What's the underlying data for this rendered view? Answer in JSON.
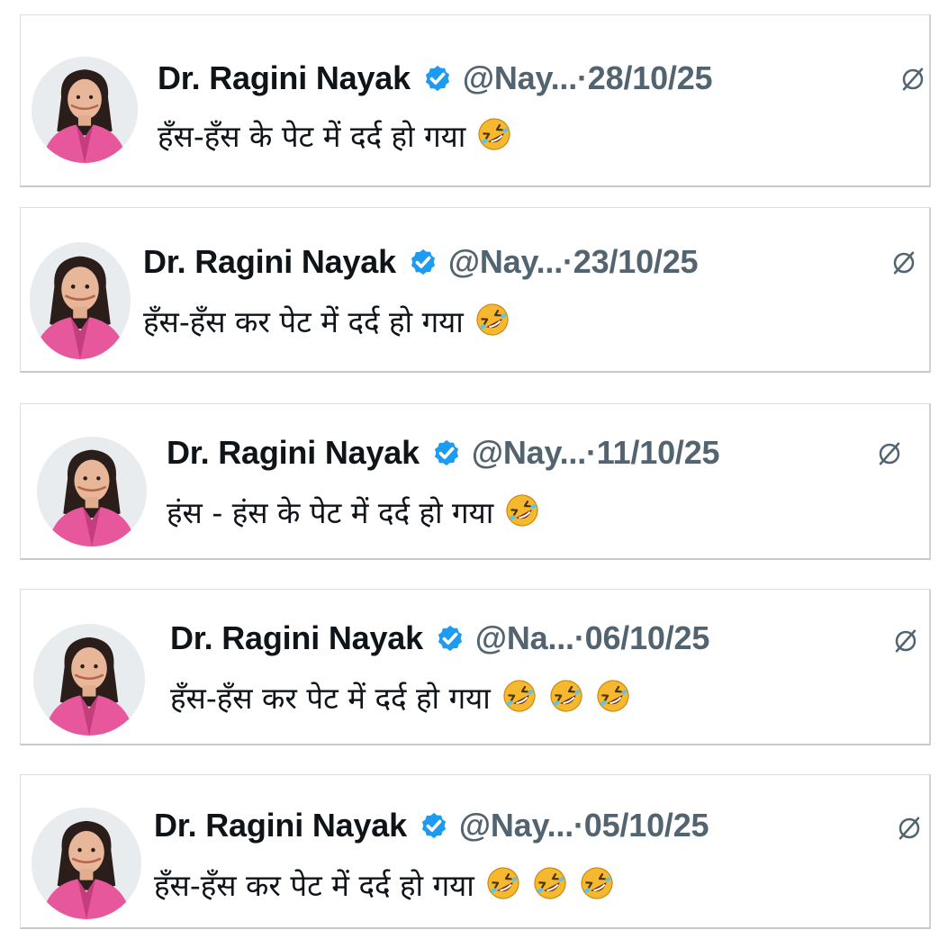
{
  "colors": {
    "name": "#0f1419",
    "secondary": "#536471",
    "verified": "#1d9bf0",
    "avatar_outfit": "#e6579b"
  },
  "icons": {
    "verified": "verified-badge-icon",
    "grok": "grok-icon",
    "emoji": "rolling-on-the-floor-laughing-emoji"
  },
  "tweets": [
    {
      "name": "Dr. Ragini Nayak",
      "handle": "@Nay...",
      "date": "·28/10/25",
      "text": "हँस-हँस के पेट में दर्द हो गया",
      "emoji_count": 1
    },
    {
      "name": "Dr. Ragini Nayak",
      "handle": "@Nay...",
      "date": "·23/10/25",
      "text": "हँस-हँस कर पेट में दर्द हो गया",
      "emoji_count": 1
    },
    {
      "name": "Dr. Ragini Nayak",
      "handle": "@Nay...",
      "date": "·11/10/25",
      "text": "हंस - हंस के पेट में दर्द हो गया",
      "emoji_count": 1
    },
    {
      "name": "Dr. Ragini Nayak",
      "handle": "@Na...",
      "date": "·06/10/25",
      "text": "हँस-हँस कर पेट में दर्द हो गया",
      "emoji_count": 3
    },
    {
      "name": "Dr. Ragini Nayak",
      "handle": "@Nay...",
      "date": "·05/10/25",
      "text": "हँस-हँस कर पेट में दर्द हो गया",
      "emoji_count": 3
    }
  ]
}
